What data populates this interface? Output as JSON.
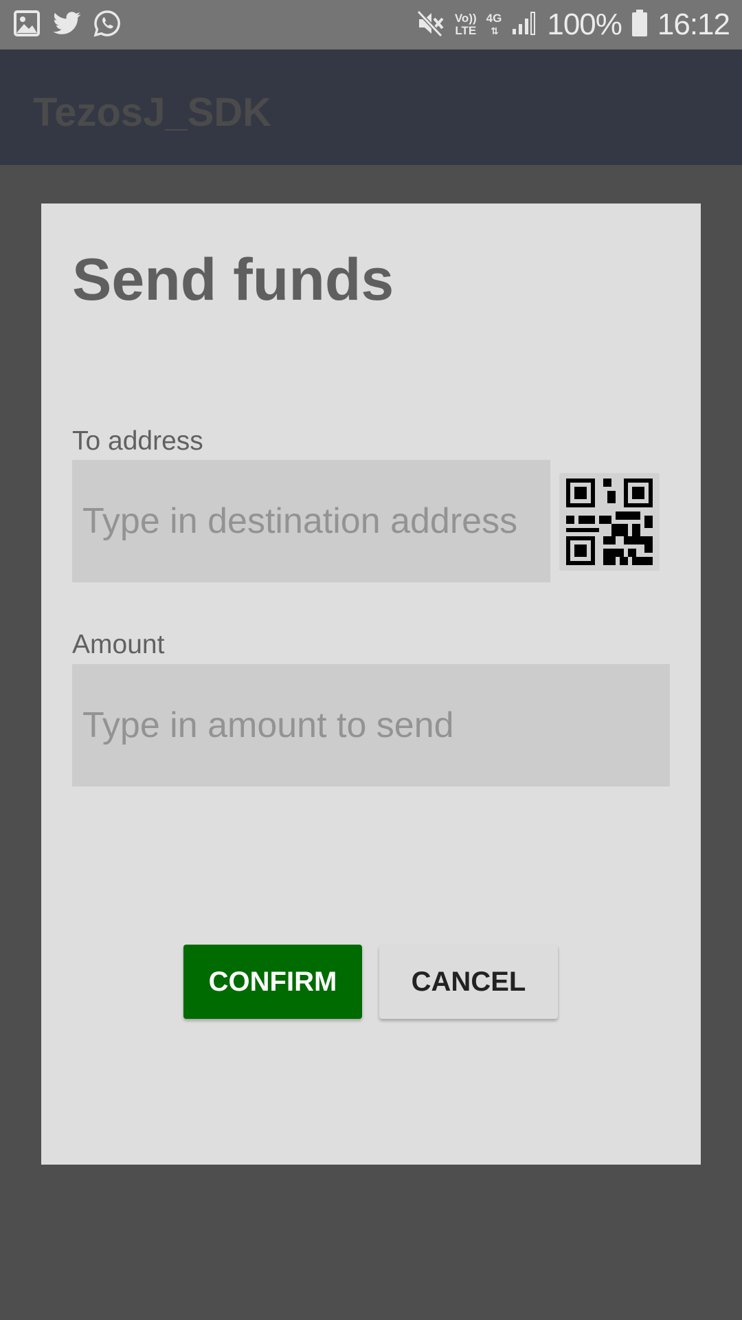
{
  "status_bar": {
    "icons_left": [
      "image-icon",
      "twitter-icon",
      "whatsapp-icon"
    ],
    "volte_top": "Vo))",
    "volte_bottom": "LTE",
    "network": "4G",
    "battery": "100%",
    "time": "16:12"
  },
  "app_bar": {
    "title": "TezosJ_SDK"
  },
  "dialog": {
    "title": "Send funds",
    "to_address": {
      "label": "To address",
      "placeholder": "Type in destination address",
      "value": ""
    },
    "qr_button": {
      "icon": "qr-code-icon"
    },
    "amount": {
      "label": "Amount",
      "placeholder": "Type in amount to send",
      "value": ""
    },
    "confirm_label": "CONFIRM",
    "cancel_label": "CANCEL"
  },
  "colors": {
    "status_bar": "#757575",
    "app_bar": "#343844",
    "scrim": "#4e4e4e",
    "dialog": "#dedede",
    "confirm": "#006b00"
  }
}
